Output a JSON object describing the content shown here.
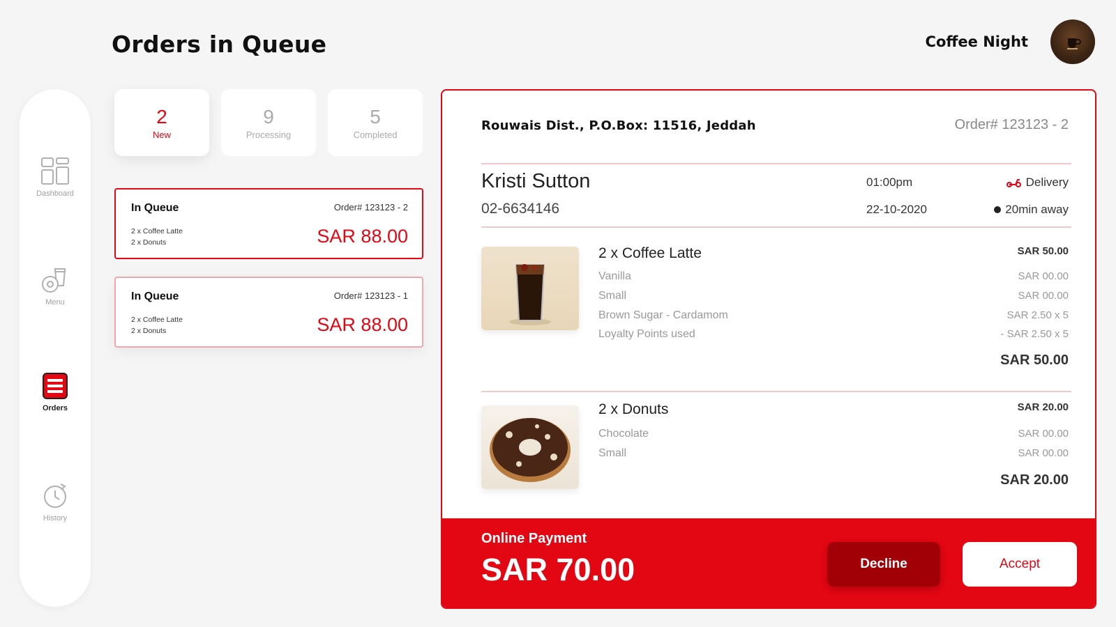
{
  "header": {
    "title": "Orders in Queue",
    "user_name": "Coffee Night"
  },
  "sidebar": {
    "items": [
      {
        "label": "Dashboard",
        "icon": "dashboard-grid-icon",
        "active": false
      },
      {
        "label": "Menu",
        "icon": "coffee-donut-icon",
        "active": false
      },
      {
        "label": "Orders",
        "icon": "orders-list-icon",
        "active": true
      },
      {
        "label": "History",
        "icon": "history-clock-icon",
        "active": false
      }
    ]
  },
  "tabs": [
    {
      "count": "2",
      "label": "New",
      "active": true
    },
    {
      "count": "9",
      "label": "Processing",
      "active": false
    },
    {
      "count": "5",
      "label": "Completed",
      "active": false
    }
  ],
  "orders": [
    {
      "status": "In Queue",
      "number": "Order# 123123 - 2",
      "items": [
        "2 x Coffee Latte",
        "2 x Donuts"
      ],
      "total": "SAR 88.00",
      "selected": true
    },
    {
      "status": "In Queue",
      "number": "Order# 123123 - 1",
      "items": [
        "2 x Coffee Latte",
        "2 x Donuts"
      ],
      "total": "SAR 88.00",
      "selected": false
    }
  ],
  "detail": {
    "address": "Rouwais Dist., P.O.Box: 11516, Jeddah",
    "order_number": "Order# 123123 - 2",
    "customer_name": "Kristi Sutton",
    "customer_phone": "02-6634146",
    "time": "01:00pm",
    "date": "22-10-2020",
    "type": "Delivery",
    "eta": "20min away",
    "items": [
      {
        "title": "2 x Coffee Latte",
        "price": "SAR 50.00",
        "options": [
          {
            "name": "Vanilla",
            "price": "SAR 00.00"
          },
          {
            "name": "Small",
            "price": "SAR 00.00"
          },
          {
            "name": "Brown Sugar - Cardamom",
            "price": "SAR 2.50 x 5"
          },
          {
            "name": "Loyalty Points used",
            "price": "- SAR 2.50 x 5"
          }
        ],
        "total": "SAR 50.00",
        "image": "iced-coffee-glass"
      },
      {
        "title": "2 x Donuts",
        "price": "SAR 20.00",
        "options": [
          {
            "name": "Chocolate",
            "price": "SAR 00.00"
          },
          {
            "name": "Small",
            "price": "SAR 00.00"
          }
        ],
        "total": "SAR 20.00",
        "image": "chocolate-donut"
      }
    ],
    "payment_method": "Online Payment",
    "payment_total": "SAR 70.00",
    "decline_label": "Decline",
    "accept_label": "Accept"
  },
  "colors": {
    "accent": "#e30613",
    "accent_dark": "#a10006",
    "background": "#f5f5f5"
  }
}
